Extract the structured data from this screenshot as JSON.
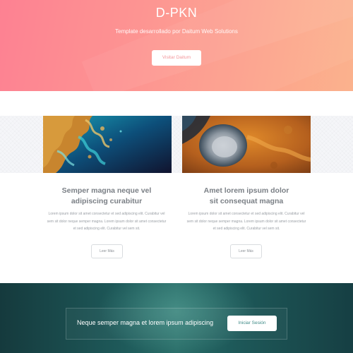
{
  "hero": {
    "title": "D-PKN",
    "subtitle": "Template desarrollado por Daitum Web Solutions",
    "button_label": "Visitar Daitum"
  },
  "features": [
    {
      "image": "satellite-coast-aerial",
      "heading_line1": "Semper magna neque vel",
      "heading_line2": "adipiscing curabitur",
      "text_lines": [
        "Lorem ipsum dolor sit amet consectetur et sed adipiscing elit. Curabitur vel",
        "sem sit dolor neque semper magna. Lorem ipsum dolor sit amet consectetur",
        "et sed adipiscing elit. Curabitur vel sem sit."
      ],
      "button_label": "Leer Más"
    },
    {
      "image": "crater-desert-aerial",
      "heading_line1": "Amet lorem ipsum dolor",
      "heading_line2": "sit consequat magna",
      "text_lines": [
        "Lorem ipsum dolor sit amet consectetur et sed adipiscing elit. Curabitur vel",
        "sem sit dolor neque semper magna. Lorem ipsum dolor sit amet consectetur",
        "et sed adipiscing elit. Curabitur vel sem sit."
      ],
      "button_label": "Leer Más"
    }
  ],
  "cta": {
    "text": "Neque semper magna et lorem ipsum adipiscing",
    "button_label": "Iniciar Sesión"
  },
  "colors": {
    "hero_gradient_start": "#fd7a8c",
    "hero_gradient_end": "#fbb28d",
    "cta_dark": "#153a3d",
    "cta_teal": "#2a6e69",
    "text_gray": "#7a7f85"
  }
}
